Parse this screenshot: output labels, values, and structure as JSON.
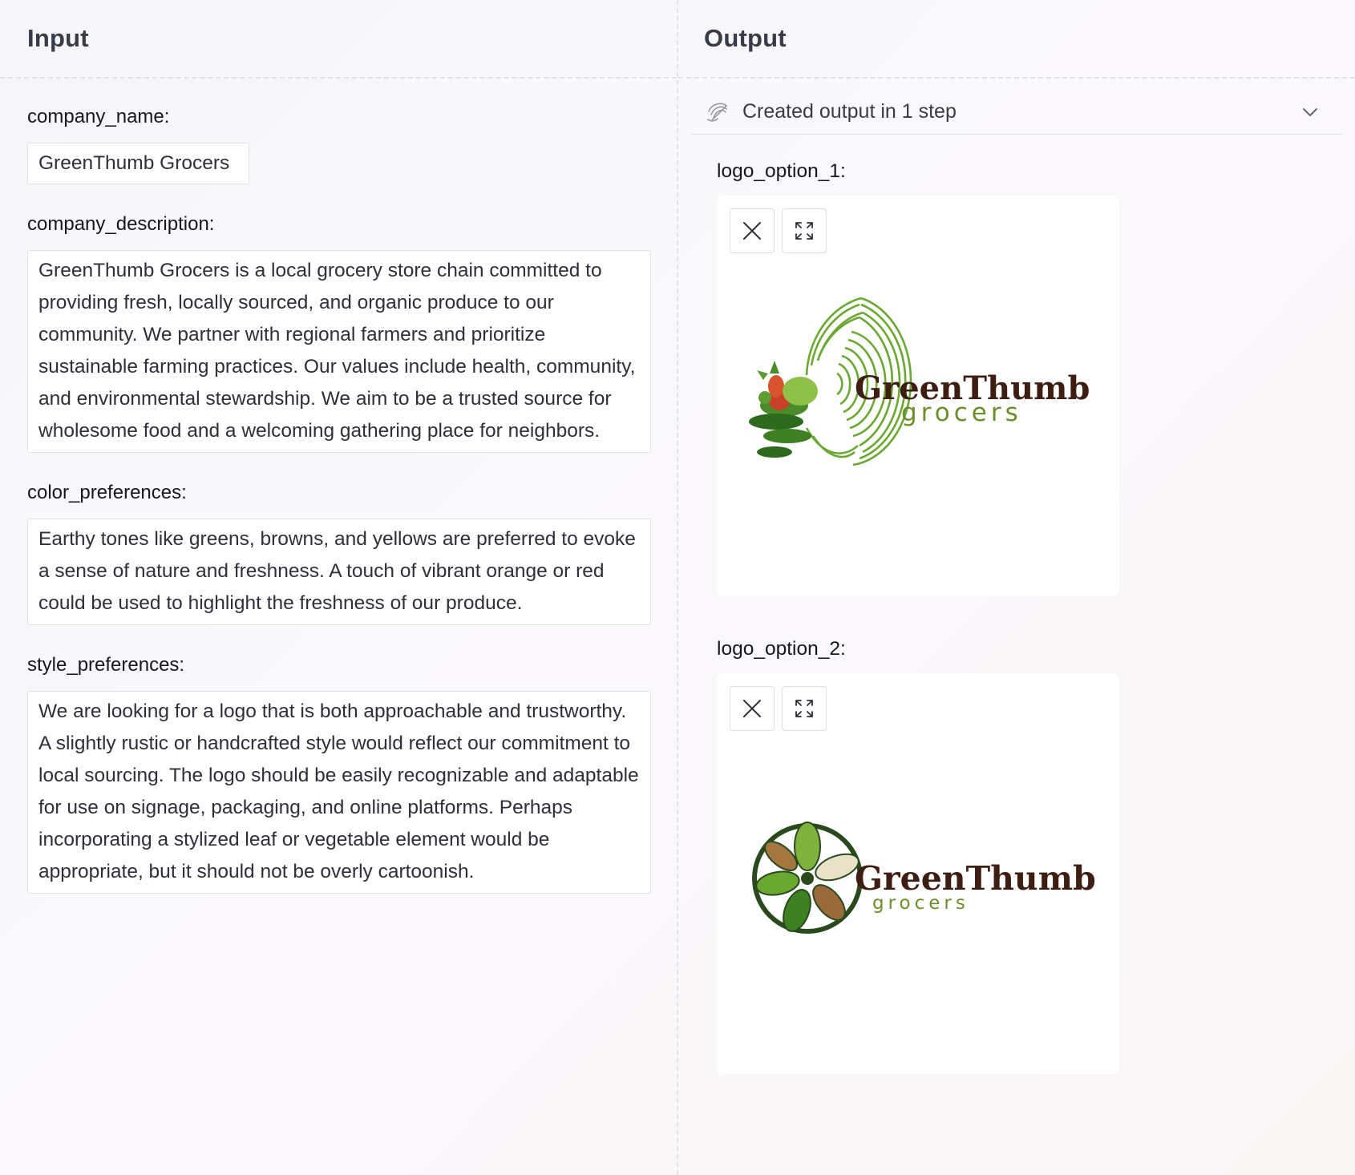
{
  "input": {
    "title": "Input",
    "fields": [
      {
        "label": "company_name:",
        "value": "GreenThumb Grocers"
      },
      {
        "label": "company_description:",
        "value": "GreenThumb Grocers is a local grocery store chain committed to providing fresh, locally sourced, and organic produce to our community. We partner with regional farmers and prioritize sustainable farming practices. Our values include health, community, and environmental stewardship. We aim to be a trusted source for wholesome food and a welcoming gathering place for neighbors."
      },
      {
        "label": "color_preferences:",
        "value": "Earthy tones like greens, browns, and yellows are preferred to evoke a sense of nature and freshness. A touch of vibrant orange or red could be used to highlight the freshness of our produce."
      },
      {
        "label": "style_preferences:",
        "value": "We are looking for a logo that is both approachable and trustworthy. A slightly rustic or handcrafted style would reflect our commitment to local sourcing. The logo should be easily recognizable and adaptable for use on signage, packaging, and online platforms. Perhaps incorporating a stylized leaf or vegetable element would be appropriate, but it should not be overly cartoonish."
      }
    ]
  },
  "output": {
    "title": "Output",
    "step_summary": "Created output in 1 step",
    "step_icon": "steps-icon",
    "toggle_icon": "chevron-down-icon",
    "images": [
      {
        "label": "logo_option_1:",
        "logo_word": "GreenThumb",
        "logo_sub": "grocers"
      },
      {
        "label": "logo_option_2:",
        "logo_word": "GreenThumb",
        "logo_sub": "grocers"
      }
    ],
    "image_actions": {
      "close_icon": "close-icon",
      "expand_icon": "expand-icon"
    }
  },
  "colors": {
    "logo_green": "#6aa832",
    "logo_dark_green": "#2d5a1e",
    "logo_brown": "#3e1e12",
    "logo_olive": "#6a8f2a",
    "logo_red": "#c8402a"
  }
}
